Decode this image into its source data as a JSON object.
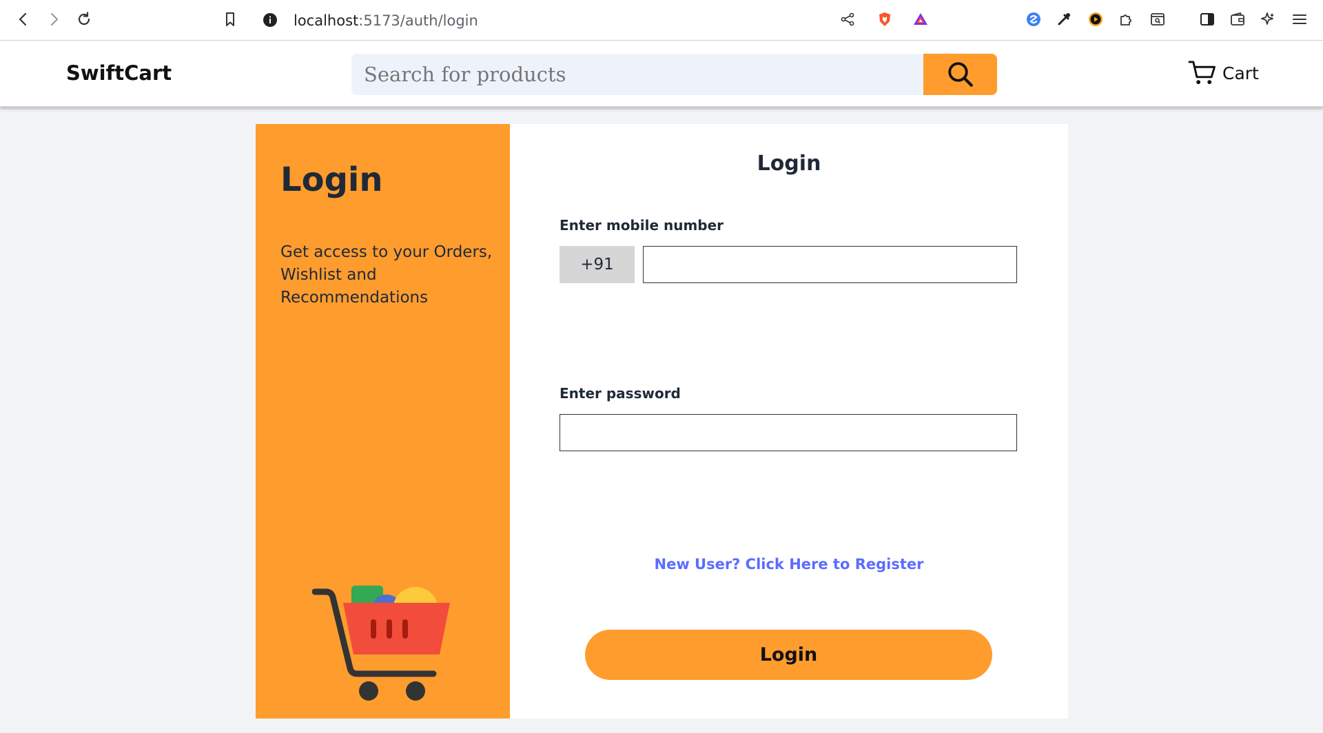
{
  "browser": {
    "url_host": "localhost",
    "url_path": ":5173/auth/login"
  },
  "header": {
    "brand": "SwiftCart",
    "search_placeholder": "Search for products",
    "cart_label": "Cart"
  },
  "side_panel": {
    "title": "Login",
    "description": "Get access to your Orders, Wishlist and Recommendations"
  },
  "form": {
    "title": "Login",
    "mobile_label": "Enter mobile number",
    "country_code": "+91",
    "mobile_value": "",
    "password_label": "Enter password",
    "password_value": "",
    "register_link": "New User? Click Here to Register",
    "submit_label": "Login"
  },
  "colors": {
    "accent": "#ff9c2e",
    "link": "#5b6cff",
    "page_bg": "#f1f3f6"
  },
  "icons": [
    "back-icon",
    "forward-icon",
    "reload-icon",
    "bookmark-icon",
    "site-info-icon",
    "share-icon",
    "brave-shields-icon",
    "brave-rewards-icon",
    "extension-icon",
    "eyedropper-icon",
    "media-icon",
    "puzzle-icon",
    "reader-icon",
    "sidebar-icon",
    "wallet-icon",
    "leo-icon",
    "menu-icon",
    "search-icon",
    "cart-icon"
  ]
}
